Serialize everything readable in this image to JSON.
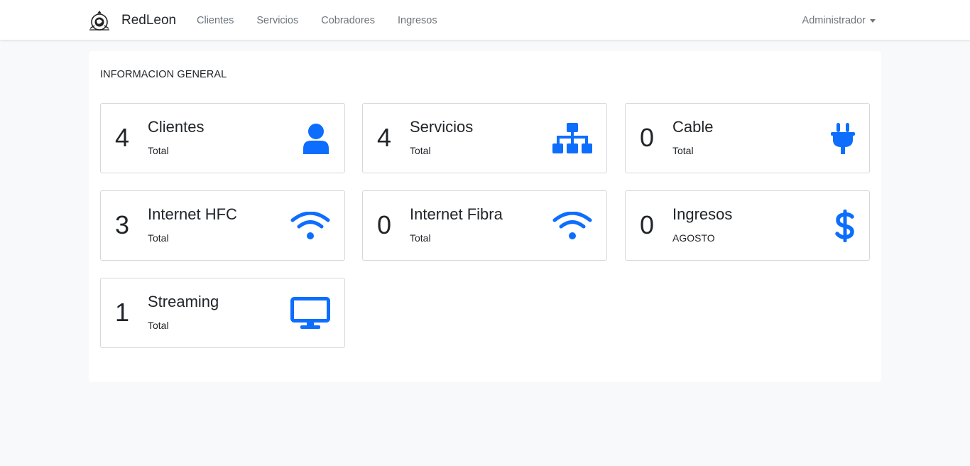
{
  "navbar": {
    "brand": "RedLeon",
    "links": [
      "Clientes",
      "Servicios",
      "Cobradores",
      "Ingresos"
    ],
    "user": "Administrador"
  },
  "main": {
    "title": "INFORMACION GENERAL",
    "stats": [
      {
        "value": "4",
        "title": "Clientes",
        "sub": "Total",
        "icon": "user-icon"
      },
      {
        "value": "4",
        "title": "Servicios",
        "sub": "Total",
        "icon": "sitemap-icon"
      },
      {
        "value": "0",
        "title": "Cable",
        "sub": "Total",
        "icon": "plug-icon"
      },
      {
        "value": "3",
        "title": "Internet HFC",
        "sub": "Total",
        "icon": "wifi-icon"
      },
      {
        "value": "0",
        "title": "Internet Fibra",
        "sub": "Total",
        "icon": "wifi-icon"
      },
      {
        "value": "0",
        "title": "Ingresos",
        "sub": "AGOSTO",
        "icon": "dollar-icon"
      },
      {
        "value": "1",
        "title": "Streaming",
        "sub": "Total",
        "icon": "monitor-icon"
      }
    ]
  },
  "colors": {
    "accent": "#0d6efd",
    "background": "#f8f9fa",
    "nav_text": "#6c757d"
  }
}
